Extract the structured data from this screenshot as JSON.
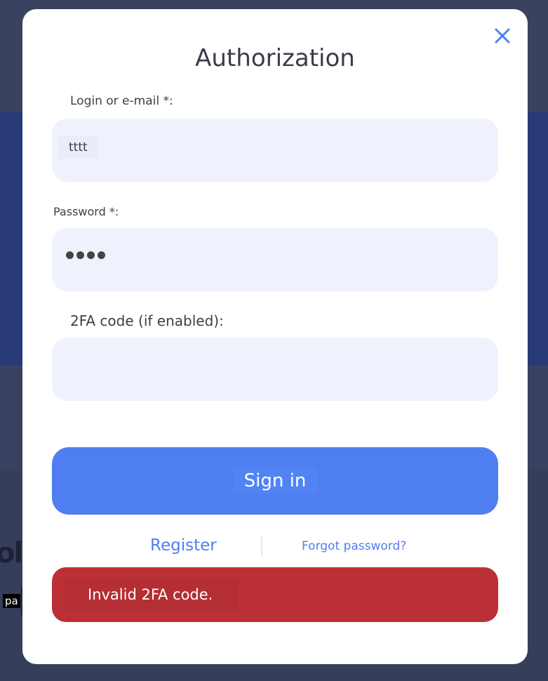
{
  "background": {
    "partial_letters": "ol",
    "tooltip_label": "pa"
  },
  "modal": {
    "title": "Authorization",
    "close_icon": "close-icon",
    "login": {
      "label": "Login or e-mail *:",
      "value": "tttt",
      "placeholder": ""
    },
    "password": {
      "label": "Password *:",
      "masked_length": 4
    },
    "twofa": {
      "label": "2FA code (if enabled):",
      "value": ""
    },
    "signin_label": "Sign in",
    "register_label": "Register",
    "forgot_label": "Forgot password?",
    "error_message": "Invalid 2FA code."
  },
  "colors": {
    "accent": "#4f7ef0",
    "error": "#bb3036",
    "input_bg": "#eff2fd",
    "overlay": "#36405d"
  }
}
